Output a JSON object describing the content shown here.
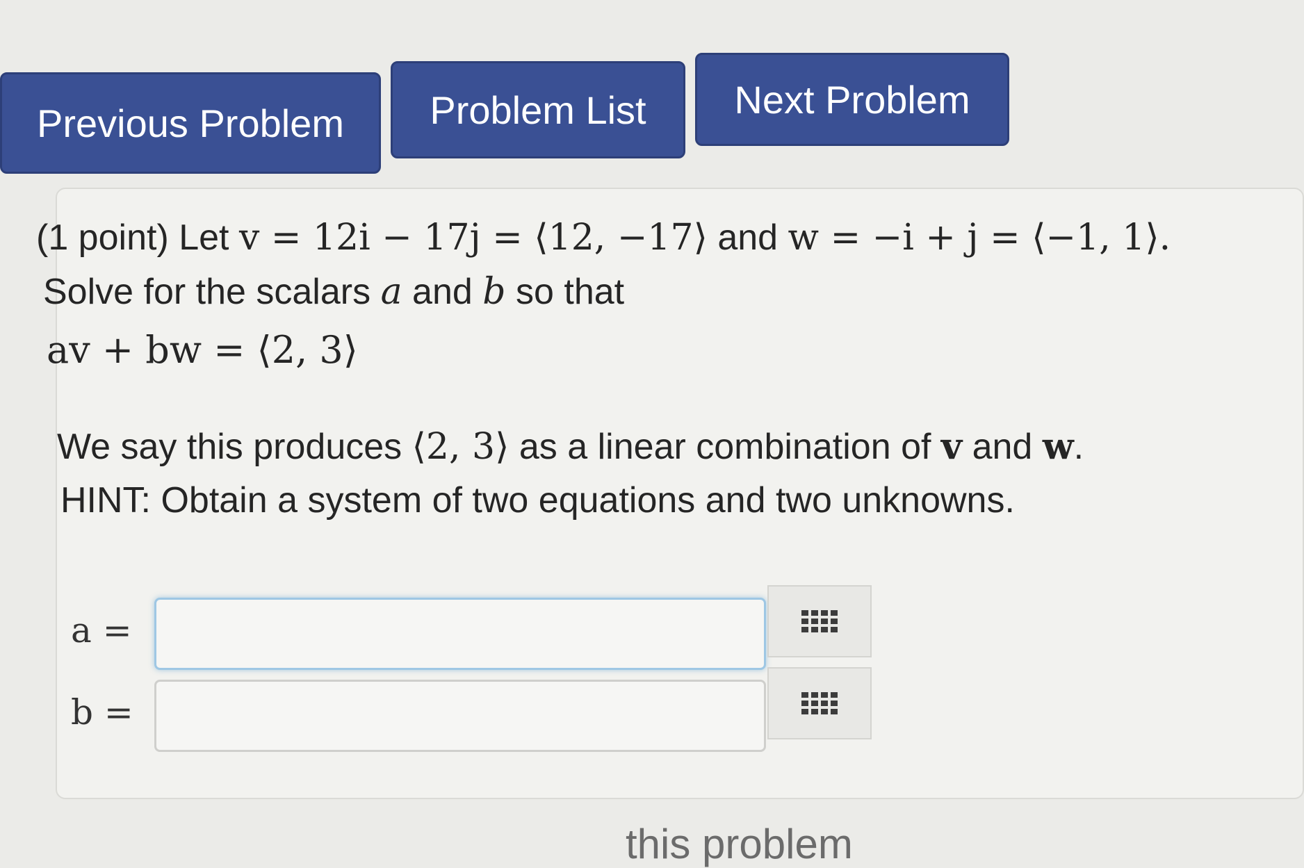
{
  "nav": {
    "previous": "Previous Problem",
    "list": "Problem List",
    "next": "Next Problem"
  },
  "problem": {
    "points": "(1 point)",
    "let": "Let",
    "v_def": "v = 12i − 17j = ⟨12, −17⟩",
    "and": "and",
    "w_def": "w = −i + j = ⟨−1, 1⟩.",
    "solve_prefix": "Solve for the scalars",
    "scalar_a": "a",
    "and2": "and",
    "scalar_b": "b",
    "solve_suffix": "so that",
    "equation": "av + bw = ⟨2, 3⟩",
    "linear_prefix": "We say this produces",
    "linear_vec": "⟨2, 3⟩",
    "linear_mid": "as a linear combination of",
    "vec_v": "v",
    "and3": "and",
    "vec_w": "w",
    "period": ".",
    "hint": "HINT: Obtain a system of two equations and two unknowns."
  },
  "answers": {
    "a_label": "a =",
    "a_value": "",
    "b_label": "b =",
    "b_value": ""
  },
  "footer": {
    "partial_text": "this problem"
  }
}
